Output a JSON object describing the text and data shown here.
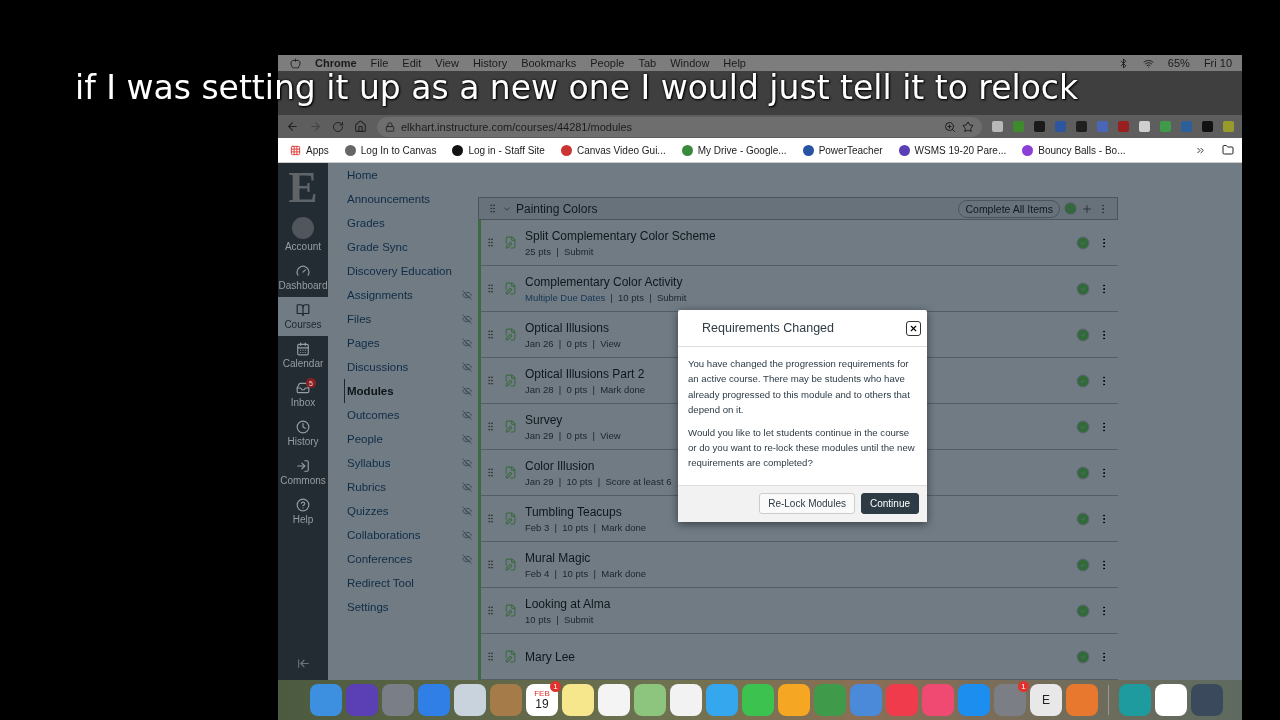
{
  "caption": "if I was setting it up as a new one I would just tell it to relock",
  "menubar": {
    "app": "Chrome",
    "items": [
      "File",
      "Edit",
      "View",
      "History",
      "Bookmarks",
      "People",
      "Tab",
      "Window",
      "Help"
    ],
    "battery": "65%",
    "clock": "Fri 10"
  },
  "address_bar": {
    "url": "elkhart.instructure.com/courses/44281/modules"
  },
  "bookmarks": [
    {
      "label": "Apps",
      "kind": "apps"
    },
    {
      "label": "Log In to Canvas",
      "kind": "canvas"
    },
    {
      "label": "Log in - Staff Site",
      "kind": "staff"
    },
    {
      "label": "Canvas Video Gui...",
      "kind": "video"
    },
    {
      "label": "My Drive - Google...",
      "kind": "drive"
    },
    {
      "label": "PowerTeacher",
      "kind": "power"
    },
    {
      "label": "WSMS 19-20 Pare...",
      "kind": "wsms"
    },
    {
      "label": "Bouncy Balls - Bo...",
      "kind": "ball"
    }
  ],
  "global_nav": {
    "logo": "E",
    "items": [
      {
        "label": "Account",
        "kind": "account",
        "selected": false
      },
      {
        "label": "Dashboard",
        "kind": "dashboard",
        "selected": false
      },
      {
        "label": "Courses",
        "kind": "courses",
        "selected": true
      },
      {
        "label": "Calendar",
        "kind": "calendar",
        "selected": false
      },
      {
        "label": "Inbox",
        "kind": "inbox",
        "selected": false,
        "badge": "5"
      },
      {
        "label": "History",
        "kind": "history",
        "selected": false
      },
      {
        "label": "Commons",
        "kind": "commons",
        "selected": false
      },
      {
        "label": "Help",
        "kind": "help",
        "selected": false
      }
    ]
  },
  "course_nav": [
    {
      "label": "Home",
      "hidden": false,
      "selected": false
    },
    {
      "label": "Announcements",
      "hidden": false,
      "selected": false
    },
    {
      "label": "Grades",
      "hidden": false,
      "selected": false
    },
    {
      "label": "Grade Sync",
      "hidden": false,
      "selected": false
    },
    {
      "label": "Discovery Education",
      "hidden": false,
      "selected": false
    },
    {
      "label": "Assignments",
      "hidden": true,
      "selected": false
    },
    {
      "label": "Files",
      "hidden": true,
      "selected": false
    },
    {
      "label": "Pages",
      "hidden": true,
      "selected": false
    },
    {
      "label": "Discussions",
      "hidden": true,
      "selected": false
    },
    {
      "label": "Modules",
      "hidden": true,
      "selected": true
    },
    {
      "label": "Outcomes",
      "hidden": true,
      "selected": false
    },
    {
      "label": "People",
      "hidden": true,
      "selected": false
    },
    {
      "label": "Syllabus",
      "hidden": true,
      "selected": false
    },
    {
      "label": "Rubrics",
      "hidden": true,
      "selected": false
    },
    {
      "label": "Quizzes",
      "hidden": true,
      "selected": false
    },
    {
      "label": "Collaborations",
      "hidden": true,
      "selected": false
    },
    {
      "label": "Conferences",
      "hidden": true,
      "selected": false
    },
    {
      "label": "Redirect Tool",
      "hidden": false,
      "selected": false
    },
    {
      "label": "Settings",
      "hidden": false,
      "selected": false
    }
  ],
  "module": {
    "title": "Painting Colors",
    "expanded": true,
    "complete_all": "Complete All Items",
    "items": [
      {
        "title": "Split Complementary Color Scheme",
        "meta": "25 pts  |  Submit",
        "completed": true
      },
      {
        "title": "Complementary Color Activity",
        "link": "Multiple Due Dates",
        "meta": "|  10 pts  |  Submit",
        "completed": true
      },
      {
        "title": "Optical Illusions",
        "meta": "Jan 26  |  0 pts  |  View",
        "completed": true
      },
      {
        "title": "Optical Illusions Part 2",
        "meta": "Jan 28  |  0 pts  |  Mark done",
        "completed": true
      },
      {
        "title": "Survey",
        "meta": "Jan 29  |  0 pts  |  View",
        "completed": true
      },
      {
        "title": "Color Illusion",
        "meta": "Jan 29  |  10 pts  |  Score at least 6",
        "completed": true
      },
      {
        "title": "Tumbling Teacups",
        "meta": "Feb 3  |  10 pts  |  Mark done",
        "completed": true
      },
      {
        "title": "Mural Magic",
        "meta": "Feb 4  |  10 pts  |  Mark done",
        "completed": true
      },
      {
        "title": "Looking at Alma",
        "meta": "10 pts  |  Submit",
        "completed": true
      },
      {
        "title": "Mary Lee",
        "completed": true
      }
    ]
  },
  "dialog": {
    "title": "Requirements Changed",
    "paragraphs": [
      "You have changed the progression requirements for an active course. There may be students who have already progressed to this module and to others that depend on it.",
      "Would you like to let students continue in the course or do you want to re-lock these modules until the new requirements are completed?"
    ],
    "buttons": [
      {
        "label": "Re-Lock Modules",
        "primary": false
      },
      {
        "label": "Continue",
        "primary": true
      }
    ]
  },
  "dock": [
    {
      "kind": "finder"
    },
    {
      "kind": "siri"
    },
    {
      "kind": "launchpad"
    },
    {
      "kind": "safari"
    },
    {
      "kind": "mail"
    },
    {
      "kind": "contacts"
    },
    {
      "kind": "calendar",
      "month": "FEB",
      "day": "19",
      "badge": "1"
    },
    {
      "kind": "notes"
    },
    {
      "kind": "reminders"
    },
    {
      "kind": "maps"
    },
    {
      "kind": "photos"
    },
    {
      "kind": "messages"
    },
    {
      "kind": "facetime"
    },
    {
      "kind": "pages"
    },
    {
      "kind": "numbers"
    },
    {
      "kind": "keynote"
    },
    {
      "kind": "news"
    },
    {
      "kind": "music"
    },
    {
      "kind": "appstore"
    },
    {
      "kind": "prefs",
      "badge": "1"
    },
    {
      "kind": "letter",
      "letter": "E"
    },
    {
      "kind": "present"
    },
    {
      "kind": "sep"
    },
    {
      "kind": "webex"
    },
    {
      "kind": "chrome"
    },
    {
      "kind": "quicktime"
    }
  ]
}
